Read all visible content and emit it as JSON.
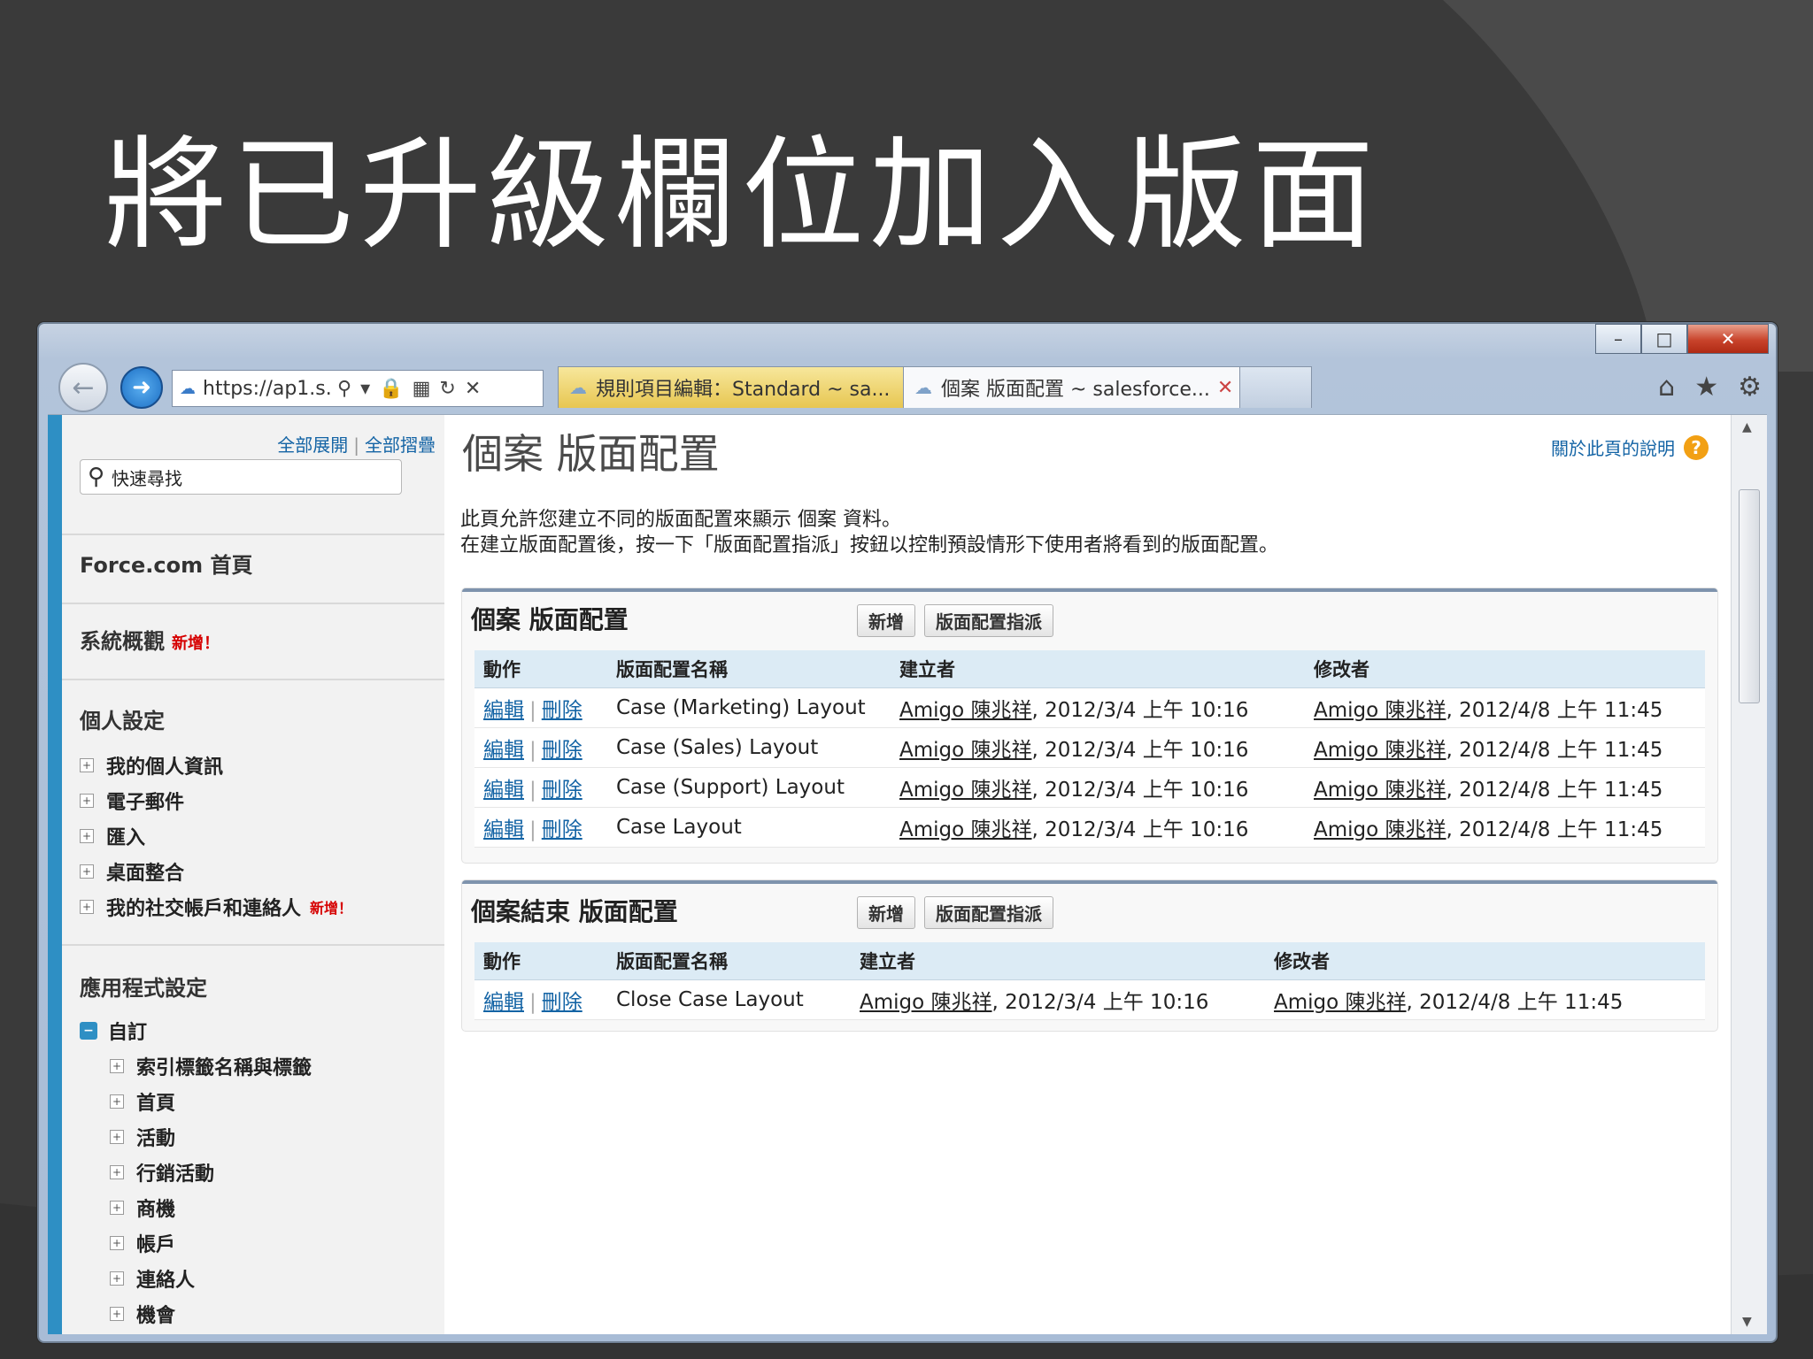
{
  "slide": {
    "title": "將已升級欄位加入版面"
  },
  "browser": {
    "address": "https://ap1.s.",
    "tabs": [
      {
        "label": "規則項目編輯：Standard ~ sa..."
      },
      {
        "label": "個案 版面配置 ~ salesforce..."
      }
    ],
    "window_controls": {
      "minimize": "–",
      "maximize": "□",
      "close": "✕"
    }
  },
  "sidebar": {
    "expand_all": "全部展開",
    "collapse_all": "全部摺疊",
    "search_placeholder": "快速尋找",
    "force_home": "Force.com 首頁",
    "system_overview": "系統概觀",
    "new_badge": "新增！",
    "personal_setup": "個人設定",
    "personal_items": [
      {
        "label": "我的個人資訊"
      },
      {
        "label": "電子郵件"
      },
      {
        "label": "匯入"
      },
      {
        "label": "桌面整合"
      },
      {
        "label": "我的社交帳戶和連絡人",
        "badge": "新增！"
      }
    ],
    "app_setup": "應用程式設定",
    "customize": "自訂",
    "customize_items": [
      {
        "label": "索引標籤名稱與標籤"
      },
      {
        "label": "首頁"
      },
      {
        "label": "活動"
      },
      {
        "label": "行銷活動"
      },
      {
        "label": "商機"
      },
      {
        "label": "帳戶"
      },
      {
        "label": "連絡人"
      },
      {
        "label": "機會"
      }
    ]
  },
  "main": {
    "page_title": "個案 版面配置",
    "help_link": "關於此頁的說明",
    "intro_line1": "此頁允許您建立不同的版面配置來顯示 個案 資料。",
    "intro_line2": "在建立版面配置後，按一下「版面配置指派」按鈕以控制預設情形下使用者將看到的版面配置。",
    "buttons": {
      "new": "新增",
      "assign": "版面配置指派"
    },
    "columns": {
      "action": "動作",
      "name": "版面配置名稱",
      "created": "建立者",
      "modified": "修改者"
    },
    "actions": {
      "edit": "編輯",
      "delete": "刪除"
    },
    "section1": {
      "title": "個案 版面配置",
      "rows": [
        {
          "name": "Case (Marketing) Layout",
          "created_by": "Amigo 陳兆祥",
          "created_at": ", 2012/3/4 上午 10:16",
          "modified_by": "Amigo 陳兆祥",
          "modified_at": ", 2012/4/8 上午 11:45"
        },
        {
          "name": "Case (Sales) Layout",
          "created_by": "Amigo 陳兆祥",
          "created_at": ", 2012/3/4 上午 10:16",
          "modified_by": "Amigo 陳兆祥",
          "modified_at": ", 2012/4/8 上午 11:45"
        },
        {
          "name": "Case (Support) Layout",
          "created_by": "Amigo 陳兆祥",
          "created_at": ", 2012/3/4 上午 10:16",
          "modified_by": "Amigo 陳兆祥",
          "modified_at": ", 2012/4/8 上午 11:45"
        },
        {
          "name": "Case Layout",
          "created_by": "Amigo 陳兆祥",
          "created_at": ", 2012/3/4 上午 10:16",
          "modified_by": "Amigo 陳兆祥",
          "modified_at": ", 2012/4/8 上午 11:45"
        }
      ]
    },
    "section2": {
      "title": "個案結束 版面配置",
      "rows": [
        {
          "name": "Close Case Layout",
          "created_by": "Amigo 陳兆祥",
          "created_at": ", 2012/3/4 上午 10:16",
          "modified_by": "Amigo 陳兆祥",
          "modified_at": ", 2012/4/8 上午 11:45"
        }
      ]
    }
  }
}
